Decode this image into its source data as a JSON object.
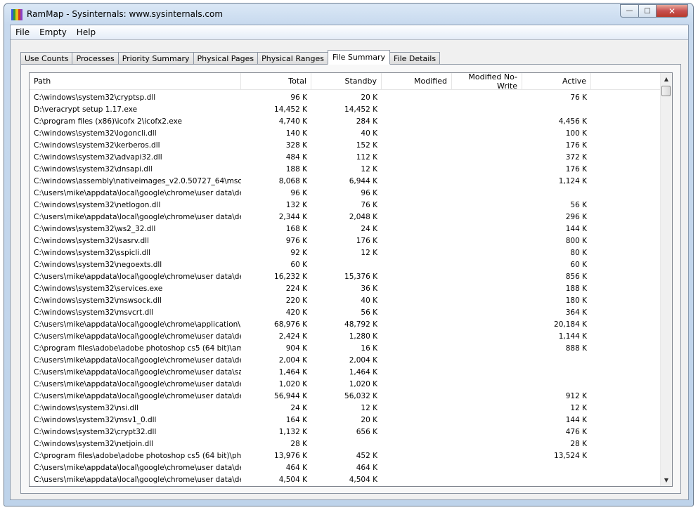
{
  "window": {
    "title": "RamMap - Sysinternals: www.sysinternals.com"
  },
  "icons": {
    "app": "rammap-app-icon",
    "minimize": "minimize-icon",
    "maximize": "maximize-icon",
    "close": "close-icon",
    "scroll_up": "scroll-up-arrow-icon",
    "scroll_down": "scroll-down-arrow-icon"
  },
  "caption": {
    "minimize": "—",
    "maximize": "□",
    "close": "✕"
  },
  "menu": [
    "File",
    "Empty",
    "Help"
  ],
  "tabs": [
    "Use Counts",
    "Processes",
    "Priority Summary",
    "Physical Pages",
    "Physical Ranges",
    "File Summary",
    "File Details"
  ],
  "active_tab": "File Summary",
  "columns": [
    "Path",
    "Total",
    "Standby",
    "Modified",
    "Modified No-Write",
    "Active"
  ],
  "rows": [
    [
      "C:\\windows\\system32\\cryptsp.dll",
      "96 K",
      "20 K",
      "",
      "",
      "76 K"
    ],
    [
      "D:\\veracrypt setup 1.17.exe",
      "14,452 K",
      "14,452 K",
      "",
      "",
      ""
    ],
    [
      "C:\\program files (x86)\\icofx 2\\icofx2.exe",
      "4,740 K",
      "284 K",
      "",
      "",
      "4,456 K"
    ],
    [
      "C:\\windows\\system32\\logoncli.dll",
      "140 K",
      "40 K",
      "",
      "",
      "100 K"
    ],
    [
      "C:\\windows\\system32\\kerberos.dll",
      "328 K",
      "152 K",
      "",
      "",
      "176 K"
    ],
    [
      "C:\\windows\\system32\\advapi32.dll",
      "484 K",
      "112 K",
      "",
      "",
      "372 K"
    ],
    [
      "C:\\windows\\system32\\dnsapi.dll",
      "188 K",
      "12 K",
      "",
      "",
      "176 K"
    ],
    [
      "C:\\windows\\assembly\\nativeimages_v2.0.50727_64\\msco...",
      "8,068 K",
      "6,944 K",
      "",
      "",
      "1,124 K"
    ],
    [
      "C:\\users\\mike\\appdata\\local\\google\\chrome\\user data\\def...",
      "96 K",
      "96 K",
      "",
      "",
      ""
    ],
    [
      "C:\\windows\\system32\\netlogon.dll",
      "132 K",
      "76 K",
      "",
      "",
      "56 K"
    ],
    [
      "C:\\users\\mike\\appdata\\local\\google\\chrome\\user data\\def...",
      "2,344 K",
      "2,048 K",
      "",
      "",
      "296 K"
    ],
    [
      "C:\\windows\\system32\\ws2_32.dll",
      "168 K",
      "24 K",
      "",
      "",
      "144 K"
    ],
    [
      "C:\\windows\\system32\\lsasrv.dll",
      "976 K",
      "176 K",
      "",
      "",
      "800 K"
    ],
    [
      "C:\\windows\\system32\\sspicli.dll",
      "92 K",
      "12 K",
      "",
      "",
      "80 K"
    ],
    [
      "C:\\windows\\system32\\negoexts.dll",
      "60 K",
      "",
      "",
      "",
      "60 K"
    ],
    [
      "C:\\users\\mike\\appdata\\local\\google\\chrome\\user data\\def...",
      "16,232 K",
      "15,376 K",
      "",
      "",
      "856 K"
    ],
    [
      "C:\\windows\\system32\\services.exe",
      "224 K",
      "36 K",
      "",
      "",
      "188 K"
    ],
    [
      "C:\\windows\\system32\\mswsock.dll",
      "220 K",
      "40 K",
      "",
      "",
      "180 K"
    ],
    [
      "C:\\windows\\system32\\msvcrt.dll",
      "420 K",
      "56 K",
      "",
      "",
      "364 K"
    ],
    [
      "C:\\users\\mike\\appdata\\local\\google\\chrome\\application\\5...",
      "68,976 K",
      "48,792 K",
      "",
      "",
      "20,184 K"
    ],
    [
      "C:\\users\\mike\\appdata\\local\\google\\chrome\\user data\\def...",
      "2,424 K",
      "1,280 K",
      "",
      "",
      "1,144 K"
    ],
    [
      "C:\\program files\\adobe\\adobe photoshop cs5 (64 bit)\\amt...",
      "904 K",
      "16 K",
      "",
      "",
      "888 K"
    ],
    [
      "C:\\users\\mike\\appdata\\local\\google\\chrome\\user data\\def...",
      "2,004 K",
      "2,004 K",
      "",
      "",
      ""
    ],
    [
      "C:\\users\\mike\\appdata\\local\\google\\chrome\\user data\\saf...",
      "1,464 K",
      "1,464 K",
      "",
      "",
      ""
    ],
    [
      "C:\\users\\mike\\appdata\\local\\google\\chrome\\user data\\def...",
      "1,020 K",
      "1,020 K",
      "",
      "",
      ""
    ],
    [
      "C:\\users\\mike\\appdata\\local\\google\\chrome\\user data\\def...",
      "56,944 K",
      "56,032 K",
      "",
      "",
      "912 K"
    ],
    [
      "C:\\windows\\system32\\nsi.dll",
      "24 K",
      "12 K",
      "",
      "",
      "12 K"
    ],
    [
      "C:\\windows\\system32\\msv1_0.dll",
      "164 K",
      "20 K",
      "",
      "",
      "144 K"
    ],
    [
      "C:\\windows\\system32\\crypt32.dll",
      "1,132 K",
      "656 K",
      "",
      "",
      "476 K"
    ],
    [
      "C:\\windows\\system32\\netjoin.dll",
      "28 K",
      "",
      "",
      "",
      "28 K"
    ],
    [
      "C:\\program files\\adobe\\adobe photoshop cs5 (64 bit)\\pho...",
      "13,976 K",
      "452 K",
      "",
      "",
      "13,524 K"
    ],
    [
      "C:\\users\\mike\\appdata\\local\\google\\chrome\\user data\\def...",
      "464 K",
      "464 K",
      "",
      "",
      ""
    ],
    [
      "C:\\users\\mike\\appdata\\local\\google\\chrome\\user data\\def...",
      "4,504 K",
      "4,504 K",
      "",
      "",
      ""
    ]
  ],
  "colors": {
    "titlebar": "#c7d9ee",
    "close_button": "#c75050",
    "app_icon_stripes": [
      "#3d5bd9",
      "#2f9a3a",
      "#e6c217",
      "#d33a2a",
      "#8a3fc4"
    ]
  }
}
